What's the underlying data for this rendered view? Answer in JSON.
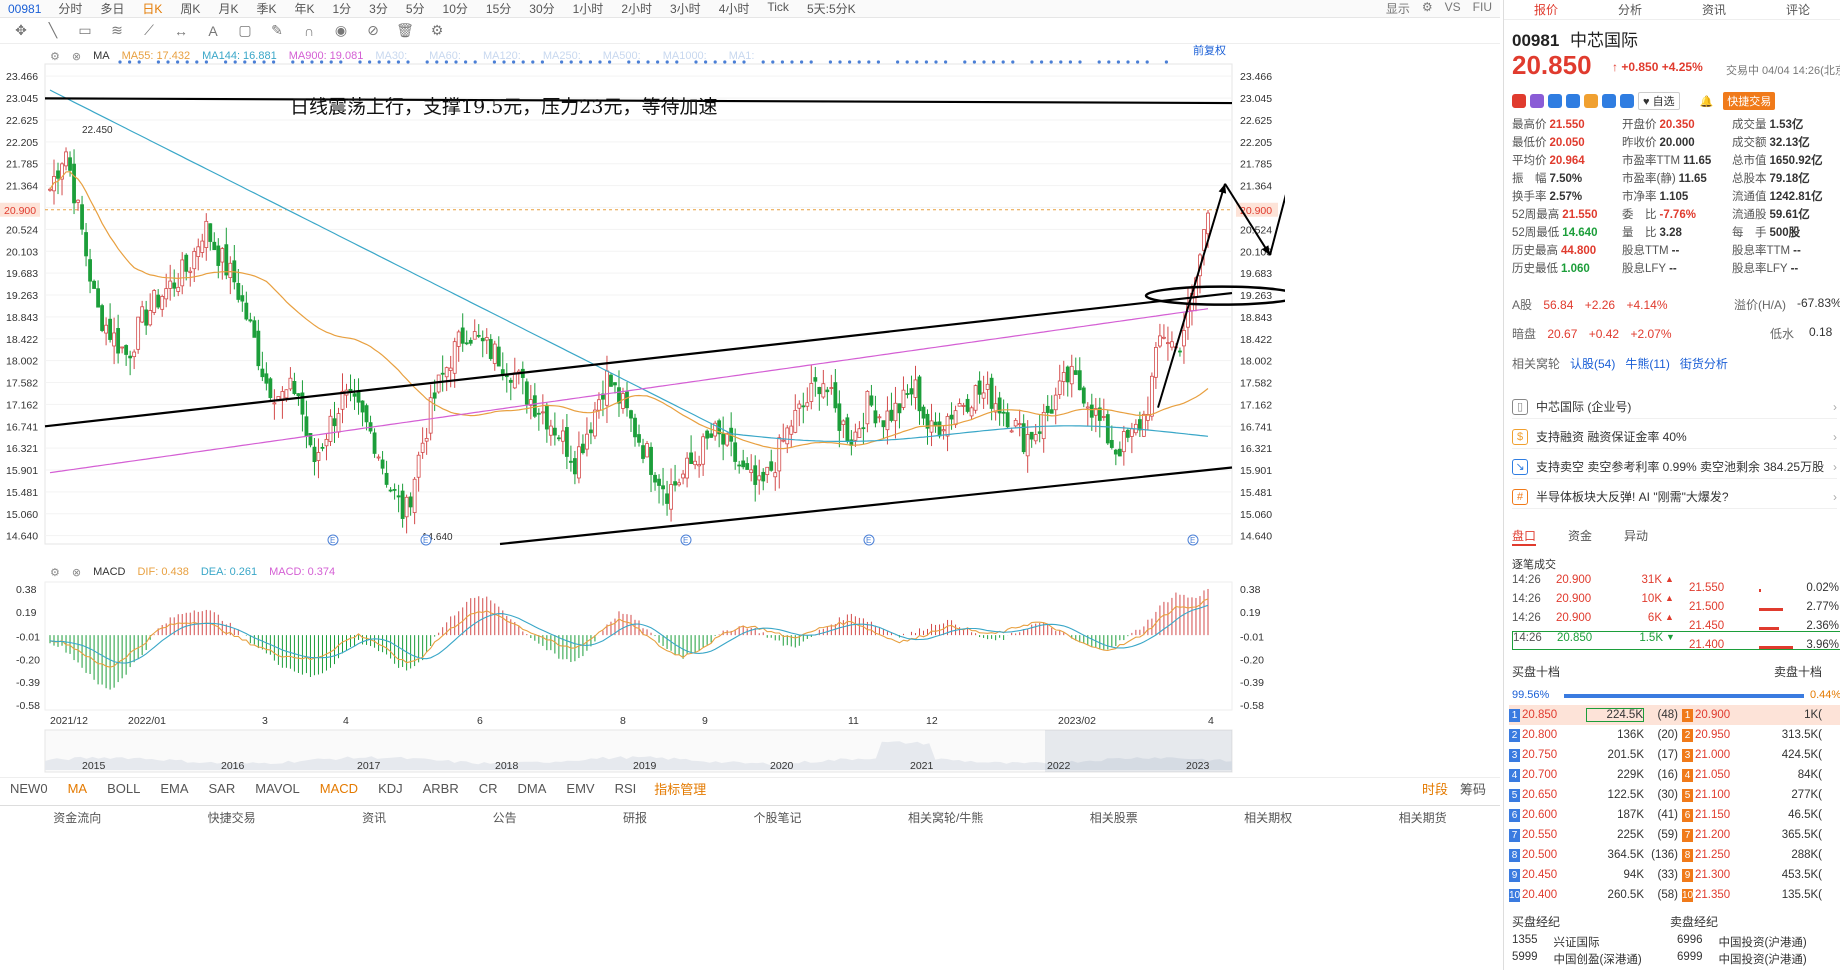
{
  "toolbar": {
    "code": "00981",
    "periods": [
      "分时",
      "多日",
      "日K",
      "周K",
      "月K",
      "季K",
      "年K",
      "1分",
      "3分",
      "5分",
      "10分",
      "15分",
      "30分",
      "1小时",
      "2小时",
      "3小时",
      "4小时",
      "Tick",
      "5天:5分K"
    ],
    "active_period": "日K",
    "right_items": [
      "显示",
      "VS",
      "FIU"
    ]
  },
  "legend": {
    "ma_name": "MA",
    "ma55": "MA55: 17.432",
    "ma144": "MA144: 16.881",
    "ma900": "MA900: 19.081",
    "others": [
      "MA30:",
      "MA60:",
      "MA120:",
      "MA250:",
      "MA500:",
      "MA1000:",
      "MA1:"
    ],
    "adjust": "前复权",
    "colors": {
      "ma55": "#e8a040",
      "ma144": "#3aa7c8",
      "ma900": "#d45fd4",
      "up": "#d34a4a",
      "down": "#1c9e3a"
    }
  },
  "annotation": "日线震荡上行，支撑19.5元，压力23元，等待加速",
  "chart_data": {
    "type": "candlestick",
    "title": "00981 中芯国际 日K",
    "y_ticks": [
      "23.466",
      "23.045",
      "22.625",
      "22.205",
      "21.785",
      "21.364",
      "20.945",
      "20.524",
      "20.103",
      "19.683",
      "19.263",
      "18.843",
      "18.422",
      "18.002",
      "17.582",
      "17.162",
      "16.741",
      "16.321",
      "15.901",
      "15.481",
      "15.060",
      "14.640"
    ],
    "ylim": [
      14.48,
      23.7
    ],
    "current_price": "20.900",
    "high_label": "22.450",
    "low_label": "14.640",
    "x_labels": [
      "2021/12",
      "2022/01",
      "3",
      "4",
      "6",
      "8",
      "9",
      "11",
      "12",
      "2023/02",
      "4"
    ],
    "approx_close_path": [
      21.3,
      22.1,
      20.6,
      19.0,
      18.5,
      18.1,
      18.8,
      19.2,
      19.5,
      19.8,
      20.6,
      20.0,
      19.5,
      18.6,
      17.6,
      17.3,
      17.5,
      16.0,
      16.7,
      17.3,
      17.0,
      16.5,
      15.6,
      15.0,
      16.3,
      17.4,
      18.1,
      18.6,
      18.3,
      18.1,
      17.8,
      17.3,
      17.0,
      16.6,
      16.1,
      16.8,
      17.7,
      17.2,
      16.6,
      16.0,
      15.5,
      15.8,
      16.2,
      16.6,
      16.3,
      15.8,
      15.5,
      16.1,
      16.8,
      17.2,
      17.7,
      16.9,
      16.5,
      17.2,
      16.9,
      17.1,
      17.5,
      16.6,
      16.9,
      17.2,
      17.4,
      17.3,
      17.0,
      16.5,
      16.7,
      17.2,
      17.7,
      17.4,
      16.8,
      16.3,
      16.5,
      17.0,
      18.6,
      18.2,
      19.2,
      20.9
    ],
    "macd": {
      "name": "MACD",
      "dif": "DIF: 0.438",
      "dea": "DEA: 0.261",
      "macd": "MACD: 0.374",
      "y_ticks": [
        "0.38",
        "0.19",
        "-0.01",
        "-0.20",
        "-0.39",
        "-0.58"
      ],
      "ylim": [
        -0.62,
        0.44
      ],
      "approx_hist": [
        -0.05,
        -0.12,
        -0.25,
        -0.4,
        -0.45,
        -0.3,
        -0.15,
        0.05,
        0.15,
        0.2,
        0.22,
        0.15,
        0.05,
        -0.05,
        -0.15,
        -0.25,
        -0.3,
        -0.35,
        -0.28,
        -0.15,
        -0.05,
        -0.1,
        -0.2,
        -0.3,
        -0.22,
        0.0,
        0.15,
        0.28,
        0.32,
        0.25,
        0.12,
        0.0,
        -0.1,
        -0.2,
        -0.22,
        -0.1,
        0.08,
        0.2,
        0.12,
        0.0,
        -0.12,
        -0.18,
        -0.12,
        -0.03,
        0.05,
        0.08,
        0.03,
        -0.05,
        -0.1,
        -0.05,
        0.05,
        0.12,
        0.18,
        0.12,
        0.05,
        0.0,
        0.02,
        0.08,
        0.12,
        0.08,
        0.0,
        -0.05,
        -0.02,
        0.05,
        0.1,
        0.06,
        -0.02,
        -0.08,
        -0.12,
        -0.08,
        0.0,
        0.1,
        0.25,
        0.35,
        0.3,
        0.38
      ]
    },
    "overview_years": [
      "2015",
      "2016",
      "2017",
      "2018",
      "2019",
      "2020",
      "2021",
      "2022",
      "2023"
    ]
  },
  "indicators": {
    "tabs": [
      "NEW0",
      "MA",
      "BOLL",
      "EMA",
      "SAR",
      "MAVOL",
      "MACD",
      "KDJ",
      "ARBR",
      "CR",
      "DMA",
      "EMV",
      "RSI"
    ],
    "manager": "指标管理",
    "right": [
      "时段",
      "筹码"
    ]
  },
  "bottom_tabs": [
    "资金流向",
    "快捷交易",
    "资讯",
    "公告",
    "研报",
    "个股笔记",
    "相关窝轮/牛熊",
    "相关股票",
    "相关期权",
    "相关期货"
  ],
  "panel": {
    "tabs": [
      "报价",
      "分析",
      "资讯",
      "评论"
    ],
    "code": "00981",
    "name": "中芯国际",
    "price": "20.850",
    "change": "+0.850  +4.25%",
    "time": "交易中 04/04 14:26(北京)",
    "watch": "自选",
    "quick_trade": "快捷交易",
    "stats": [
      [
        [
          "最高价",
          "21.550",
          "red"
        ],
        [
          "开盘价",
          "20.350",
          "red"
        ],
        [
          "成交量",
          "1.53亿",
          ""
        ]
      ],
      [
        [
          "最低价",
          "20.050",
          "red"
        ],
        [
          "昨收价",
          "20.000",
          ""
        ],
        [
          "成交额",
          "32.13亿",
          ""
        ]
      ],
      [
        [
          "平均价",
          "20.964",
          "red"
        ],
        [
          "市盈率TTM",
          "11.65",
          ""
        ],
        [
          "总市值",
          "1650.92亿",
          ""
        ]
      ],
      [
        [
          "振　幅",
          "7.50%",
          ""
        ],
        [
          "市盈率(静)",
          "11.65",
          ""
        ],
        [
          "总股本",
          "79.18亿",
          ""
        ]
      ],
      [
        [
          "换手率",
          "2.57%",
          ""
        ],
        [
          "市净率",
          "1.105",
          ""
        ],
        [
          "流通值",
          "1242.81亿",
          ""
        ]
      ],
      [
        [
          "52周最高",
          "21.550",
          "red"
        ],
        [
          "委　比",
          "-7.76%",
          "red"
        ],
        [
          "流通股",
          "59.61亿",
          ""
        ]
      ],
      [
        [
          "52周最低",
          "14.640",
          "green"
        ],
        [
          "量　比",
          "3.28",
          ""
        ],
        [
          "每　手",
          "500股",
          ""
        ]
      ],
      [
        [
          "历史最高",
          "44.800",
          "red"
        ],
        [
          "股息TTM",
          "--",
          ""
        ],
        [
          "股息率TTM",
          "--",
          ""
        ]
      ],
      [
        [
          "历史最低",
          "1.060",
          "green"
        ],
        [
          "股息LFY",
          "--",
          ""
        ],
        [
          "股息率LFY",
          "--",
          ""
        ]
      ]
    ],
    "a_share": {
      "label": "A股",
      "price": "56.84",
      "chg": "+2.26",
      "pct": "+4.14%",
      "premium_label": "溢价(H/A)",
      "premium": "-67.83%"
    },
    "dark": {
      "label": "暗盘",
      "price": "20.67",
      "chg": "+0.42",
      "pct": "+2.07%",
      "low_label": "低水",
      "low": "0.18"
    },
    "related": [
      "相关窝轮",
      "认股(54)",
      "牛熊(11)",
      "街货分析"
    ],
    "news": [
      {
        "icon": "▯",
        "text": "中芯国际 (企业号)"
      },
      {
        "icon": "$",
        "text": "支持融资  融资保证金率 40%"
      },
      {
        "icon": "↘",
        "text": "支持卖空  卖空参考利率 0.99%  卖空池剩余 384.25万股"
      },
      {
        "icon": "#",
        "text": "半导体板块大反弹! AI \"刚需\"大爆发?"
      }
    ],
    "sub_tabs": [
      "盘口",
      "资金",
      "异动"
    ],
    "ticks_title": "逐笔成交",
    "ticks": [
      {
        "t": "14:26",
        "p": "20.900",
        "v": "31K",
        "dir": "▲"
      },
      {
        "t": "14:26",
        "p": "20.900",
        "v": "10K",
        "dir": "▲"
      },
      {
        "t": "14:26",
        "p": "20.900",
        "v": "6K",
        "dir": "▲"
      },
      {
        "t": "14:26",
        "p": "20.850",
        "v": "1.5K",
        "dir": "▼"
      }
    ],
    "dist": [
      {
        "p": "21.550",
        "pc": "0.02%"
      },
      {
        "p": "21.500",
        "pc": "2.77%"
      },
      {
        "p": "21.450",
        "pc": "2.36%"
      },
      {
        "p": "21.400",
        "pc": "3.96%"
      }
    ],
    "bid_title": "买盘十档",
    "ask_title": "卖盘十档",
    "ratio": "99.56%",
    "ratio_right": "0.44%",
    "depth": [
      {
        "bp": "20.850",
        "bv": "224.5K",
        "bc": "(48)",
        "sp": "20.900",
        "sv": "1K("
      },
      {
        "bp": "20.800",
        "bv": "136K",
        "bc": "(20)",
        "sp": "20.950",
        "sv": "313.5K("
      },
      {
        "bp": "20.750",
        "bv": "201.5K",
        "bc": "(17)",
        "sp": "21.000",
        "sv": "424.5K("
      },
      {
        "bp": "20.700",
        "bv": "229K",
        "bc": "(16)",
        "sp": "21.050",
        "sv": "84K("
      },
      {
        "bp": "20.650",
        "bv": "122.5K",
        "bc": "(30)",
        "sp": "21.100",
        "sv": "277K("
      },
      {
        "bp": "20.600",
        "bv": "187K",
        "bc": "(41)",
        "sp": "21.150",
        "sv": "46.5K("
      },
      {
        "bp": "20.550",
        "bv": "225K",
        "bc": "(59)",
        "sp": "21.200",
        "sv": "365.5K("
      },
      {
        "bp": "20.500",
        "bv": "364.5K",
        "bc": "(136)",
        "sp": "21.250",
        "sv": "288K("
      },
      {
        "bp": "20.450",
        "bv": "94K",
        "bc": "(33)",
        "sp": "21.300",
        "sv": "453.5K("
      },
      {
        "bp": "20.400",
        "bv": "260.5K",
        "bc": "(58)",
        "sp": "21.350",
        "sv": "135.5K("
      }
    ],
    "broker_bid": "买盘经纪",
    "broker_ask": "卖盘经纪",
    "brokers": [
      {
        "c1": "1355",
        "n1": "兴证国际",
        "c2": "6996",
        "n2": "中国投资(沪港通)"
      },
      {
        "c1": "5999",
        "n1": "中国创盈(深港通)",
        "c2": "6999",
        "n2": "中国投资(沪港通)"
      }
    ]
  }
}
